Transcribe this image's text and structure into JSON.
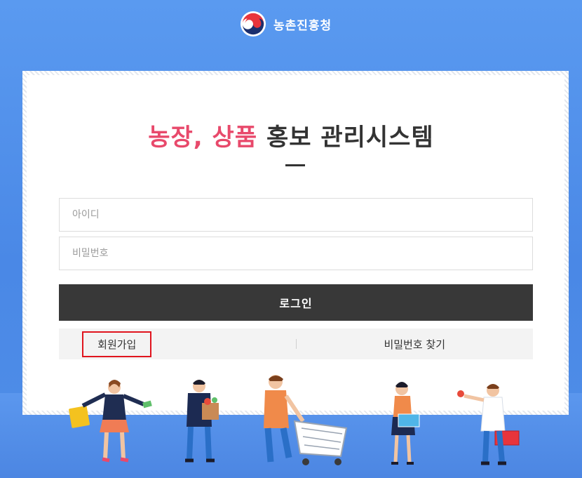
{
  "header": {
    "org_name": "농촌진흥청",
    "logo_icon": "taegeuk-logo-icon"
  },
  "title": {
    "accent": "농장, 상품",
    "rest": " 홍보 관리시스템",
    "accent_color": "#e8496b"
  },
  "form": {
    "id_placeholder": "아이디",
    "pw_placeholder": "비밀번호",
    "login_label": "로그인"
  },
  "links": {
    "signup_label": "회원가입",
    "find_pw_label": "비밀번호 찾기",
    "highlight_color": "#e0141e"
  },
  "colors": {
    "background": "#4f8ee8",
    "button": "#383838"
  }
}
